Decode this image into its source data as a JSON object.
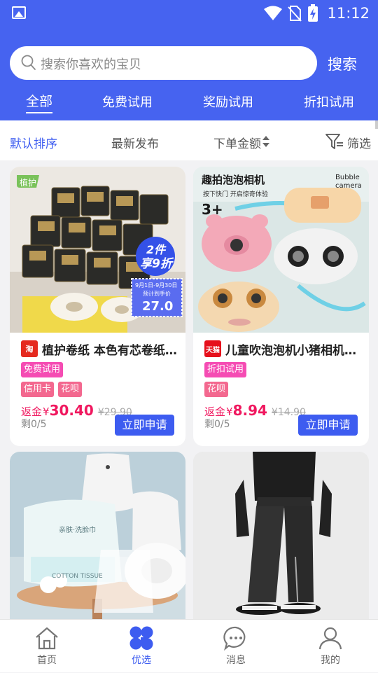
{
  "status_bar": {
    "time": "11:12"
  },
  "search": {
    "placeholder": "搜索你喜欢的宝贝",
    "button": "搜索"
  },
  "tabs": [
    {
      "label": "全部",
      "active": true
    },
    {
      "label": "免费试用"
    },
    {
      "label": "奖励试用"
    },
    {
      "label": "折扣试用"
    }
  ],
  "filters": [
    {
      "label": "默认排序",
      "active": true
    },
    {
      "label": "最新发布"
    },
    {
      "label": "下单金额"
    },
    {
      "label": "筛选"
    }
  ],
  "products": [
    {
      "shop_type": "淘宝",
      "title": "植护卷纸 本色有芯卷纸家用实惠装",
      "tags": [
        "免费试用"
      ],
      "payment_tags": [
        "信用卡",
        "花呗"
      ],
      "rebate_label": "返金",
      "currency": "¥",
      "price": "30.40",
      "original_price": "¥29.90",
      "remaining": "剩0/5",
      "button": "立即申请",
      "image": {
        "brand_badge": "植护",
        "promo_line1": "2件",
        "promo_line2": "享9折",
        "date_range": "9月1日-9月30日",
        "expected_label": "预计到手价",
        "expected_price": "27.0"
      }
    },
    {
      "shop_type": "天猫",
      "title": "儿童吹泡泡机小猪相机玩具",
      "tags": [
        "折扣试用"
      ],
      "payment_tags": [
        "花呗"
      ],
      "rebate_label": "返金",
      "currency": "¥",
      "price": "8.94",
      "original_price": "¥14.90",
      "remaining": "剩0/5",
      "button": "立即申请",
      "image": {
        "headline": "趣拍泡泡相机",
        "subline": "按下快门 开启惊奇体验",
        "age": "3+",
        "brand_en_1": "Bubble",
        "brand_en_2": "camera"
      }
    },
    {
      "image": {
        "package_text": "亲肤·洗脸巾",
        "roll_text": "COTTON TISSUE"
      }
    },
    {
      "image": {}
    }
  ],
  "bottom_nav": [
    {
      "label": "首页",
      "icon": "home-icon"
    },
    {
      "label": "优选",
      "icon": "clover-icon",
      "active": true
    },
    {
      "label": "消息",
      "icon": "chat-icon"
    },
    {
      "label": "我的",
      "icon": "user-icon"
    }
  ],
  "colors": {
    "primary": "#4663f0",
    "price": "#f0185f",
    "tag": "#f54cb3"
  }
}
